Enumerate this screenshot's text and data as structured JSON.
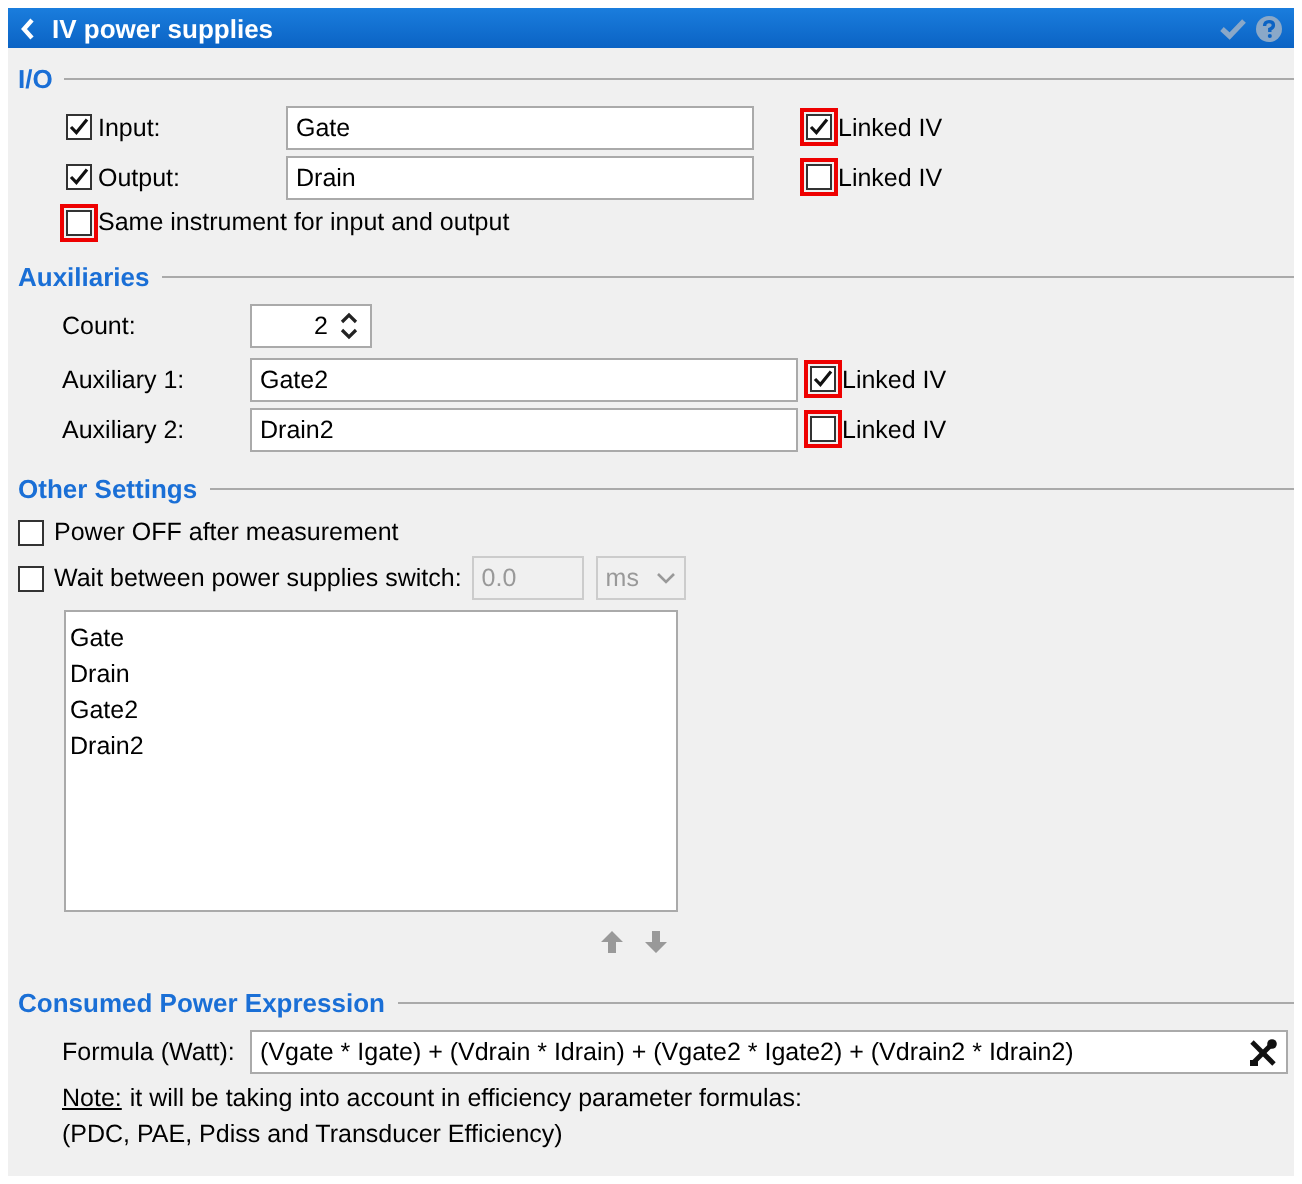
{
  "window": {
    "title": "IV power supplies"
  },
  "io": {
    "header": "I/O",
    "rows": [
      {
        "checked": true,
        "label": "Input:",
        "value": "Gate",
        "linked": {
          "checked": true,
          "highlighted": true,
          "label": "Linked IV"
        }
      },
      {
        "checked": true,
        "label": "Output:",
        "value": "Drain",
        "linked": {
          "checked": false,
          "highlighted": true,
          "label": "Linked IV"
        }
      }
    ],
    "same_instrument": {
      "checked": false,
      "highlighted": true,
      "label": "Same instrument for input and output"
    }
  },
  "auxiliaries": {
    "header": "Auxiliaries",
    "count_label": "Count:",
    "count": "2",
    "rows": [
      {
        "label": "Auxiliary 1:",
        "value": "Gate2",
        "linked": {
          "checked": true,
          "highlighted": true,
          "label": "Linked IV"
        }
      },
      {
        "label": "Auxiliary 2:",
        "value": "Drain2",
        "linked": {
          "checked": false,
          "highlighted": true,
          "label": "Linked IV"
        }
      }
    ]
  },
  "other_settings": {
    "header": "Other Settings",
    "power_off": {
      "checked": false,
      "label": "Power OFF after measurement"
    },
    "wait": {
      "checked": false,
      "label": "Wait between power supplies switch:",
      "value": "0.0",
      "unit": "ms",
      "disabled": true
    },
    "list": [
      "Gate",
      "Drain",
      "Gate2",
      "Drain2"
    ]
  },
  "consumed_power": {
    "header": "Consumed Power Expression",
    "formula_label": "Formula (Watt):",
    "formula": "(Vgate * Igate) + (Vdrain * Idrain) + (Vgate2 * Igate2) + (Vdrain2 * Idrain2)",
    "note_label": "Note:",
    "note_text": "it will be taking into account in efficiency parameter formulas:",
    "note_line2": "(PDC, PAE, Pdiss and Transducer Efficiency)"
  }
}
